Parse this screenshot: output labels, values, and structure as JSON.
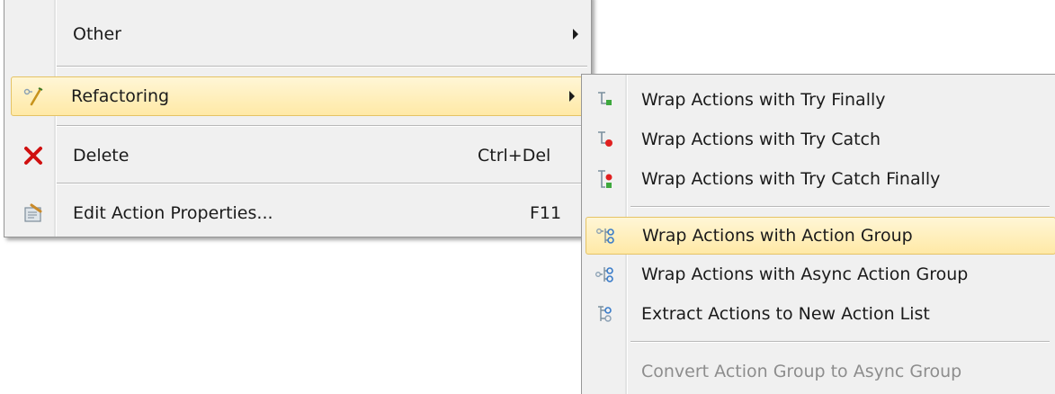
{
  "main_menu": {
    "items": [
      {
        "label": "Other",
        "shortcut": "",
        "icon": "",
        "submenu": true
      },
      {
        "label": "Refactoring",
        "shortcut": "",
        "icon": "refactor-wand-icon",
        "submenu": true,
        "highlighted": true
      },
      {
        "label": "Delete",
        "shortcut": "Ctrl+Del",
        "icon": "delete-x-icon"
      },
      {
        "label": "Edit Action Properties...",
        "shortcut": "F11",
        "icon": "properties-icon"
      }
    ]
  },
  "refactoring_submenu": {
    "items": [
      {
        "label": "Wrap Actions with Try Finally",
        "icon": "try-finally-icon"
      },
      {
        "label": "Wrap Actions with Try Catch",
        "icon": "try-catch-icon"
      },
      {
        "label": "Wrap Actions with Try Catch Finally",
        "icon": "try-catch-finally-icon"
      },
      {
        "label": "Wrap Actions with Action Group",
        "icon": "action-group-icon",
        "highlighted": true
      },
      {
        "label": "Wrap Actions with Async Action Group",
        "icon": "async-action-group-icon"
      },
      {
        "label": "Extract Actions to New Action List",
        "icon": "extract-action-list-icon"
      },
      {
        "label": "Convert Action Group to Async Group",
        "icon": "",
        "disabled": true
      }
    ]
  },
  "colors": {
    "menu_bg": "#f0f0f0",
    "highlight_top": "#fff6d6",
    "highlight_bottom": "#ffe9a6",
    "highlight_border": "#e5c365",
    "disabled_text": "#8d8d8d",
    "delete_red": "#d01010"
  }
}
